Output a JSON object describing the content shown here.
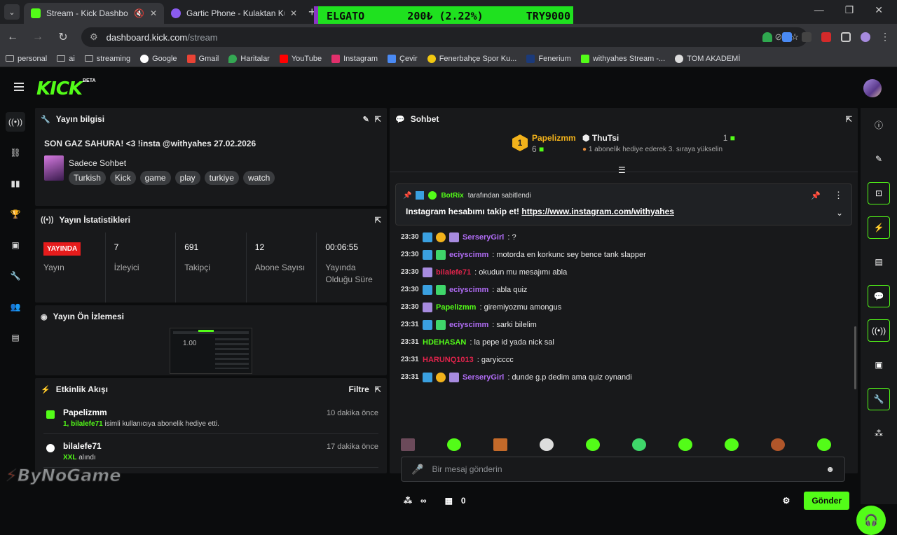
{
  "browser": {
    "tabs": [
      {
        "label": "Stream - Kick Dashboard",
        "active": true
      },
      {
        "label": "Gartic Phone - Kulaktan Kulağa",
        "active": false
      }
    ],
    "ticker": {
      "name": "ELGATO",
      "value": "200₺ (2.22%)",
      "total": "TRY9000"
    },
    "url_host": "dashboard.kick.com",
    "url_path": "/stream",
    "bookmarks": [
      "personal",
      "ai",
      "streaming",
      "Google",
      "Gmail",
      "Haritalar",
      "YouTube",
      "Instagram",
      "Çevir",
      "Fenerbahçe Spor Ku...",
      "Fenerium",
      "withyahes Stream -...",
      "TOM AKADEMİ"
    ]
  },
  "app": {
    "logo": "KICK",
    "beta": "BETA"
  },
  "stream_info": {
    "header": "Yayın bilgisi",
    "title": "SON GAZ SAHURA! <3 !insta @withyahes 27.02.2026",
    "category": "Sadece Sohbet",
    "tags": [
      "Turkish",
      "Kick",
      "game",
      "play",
      "turkiye",
      "watch"
    ]
  },
  "stats": {
    "header": "Yayın İstatistikleri",
    "live_badge": "YAYINDA",
    "items": [
      {
        "value": "",
        "label": "Yayın"
      },
      {
        "value": "7",
        "label": "İzleyici"
      },
      {
        "value": "691",
        "label": "Takipçi"
      },
      {
        "value": "12",
        "label": "Abone Sayısı"
      },
      {
        "value": "00:06:55",
        "label": "Yayında Olduğu Süre"
      }
    ]
  },
  "preview": {
    "header": "Yayın Ön İzlemesi",
    "overlay_text": "1.00"
  },
  "activity": {
    "header": "Etkinlik Akışı",
    "filter": "Filtre",
    "events": [
      {
        "user": "Papelizmm",
        "time": "10 dakika önce",
        "highlight": "1, bilalefe71",
        "detail": " isimli kullanıcıya abonelik hediye etti."
      },
      {
        "user": "bilalefe71",
        "time": "17 dakika önce",
        "highlight": "XXL",
        "detail": " alındı"
      }
    ]
  },
  "chat": {
    "header": "Sohbet",
    "top_gifter": {
      "rank": "1",
      "name": "Papelizmm",
      "count": "6"
    },
    "second": {
      "name": "ThuTsi",
      "count": "1",
      "desc": "1 abonelik hediye ederek 3. sıraya yükselin"
    },
    "pinned": {
      "by": "BotRix",
      "by_suffix": "tarafından sabitlendi",
      "text": "Instagram hesabımı takip et! ",
      "link": "https://www.instagram.com/withyahes"
    },
    "messages": [
      {
        "time": "23:30",
        "user": "SerseryGirl",
        "color": "#b06cf5",
        "text": ": ?"
      },
      {
        "time": "23:30",
        "user": "eciyscimm",
        "color": "#b06cf5",
        "text": ": motorda en korkunc sey bence tank slapper"
      },
      {
        "time": "23:30",
        "user": "bilalefe71",
        "color": "#e0234b",
        "text": ": okudun mu mesajımı abla"
      },
      {
        "time": "23:30",
        "user": "eciyscimm",
        "color": "#b06cf5",
        "text": ": abla quiz"
      },
      {
        "time": "23:30",
        "user": "Papelizmm",
        "color": "#53fc18",
        "text": ": giremiyozmu amongus"
      },
      {
        "time": "23:31",
        "user": "eciyscimm",
        "color": "#b06cf5",
        "text": ": sarki bilelim"
      },
      {
        "time": "23:31",
        "user": "HDEHASAN",
        "color": "#53fc18",
        "text": ": la pepe id yada nick sal"
      },
      {
        "time": "23:31",
        "user": "HARUNQ1013",
        "color": "#e0234b",
        "text": ": garyicccc"
      },
      {
        "time": "23:31",
        "user": "SerseryGirl",
        "color": "#b06cf5",
        "text": ": dunde g.p dedim ama quiz oynandi"
      }
    ],
    "input_placeholder": "Bir mesaj gönderin",
    "points": "∞",
    "store_count": "0",
    "send_label": "Gönder"
  },
  "watermark": "ByNoGame",
  "colors": {
    "accent": "#53fc18",
    "live": "#e61c1c",
    "panel": "#18191b"
  }
}
